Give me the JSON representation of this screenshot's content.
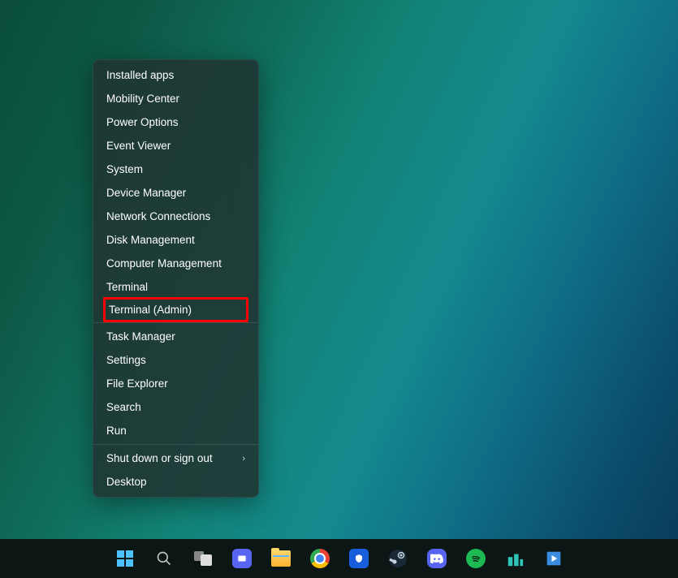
{
  "context_menu": {
    "groups": [
      [
        "Installed apps",
        "Mobility Center",
        "Power Options",
        "Event Viewer",
        "System",
        "Device Manager",
        "Network Connections",
        "Disk Management",
        "Computer Management",
        "Terminal",
        "Terminal (Admin)"
      ],
      [
        "Task Manager",
        "Settings",
        "File Explorer",
        "Search",
        "Run"
      ],
      [
        "Shut down or sign out",
        "Desktop"
      ]
    ],
    "highlighted_item": "Terminal (Admin)",
    "submenu_item": "Shut down or sign out"
  },
  "taskbar": {
    "icons": [
      "start",
      "search",
      "task-view",
      "chat",
      "file-explorer",
      "chrome",
      "bitwarden",
      "steam",
      "discord",
      "spotify",
      "app1",
      "app2"
    ]
  }
}
